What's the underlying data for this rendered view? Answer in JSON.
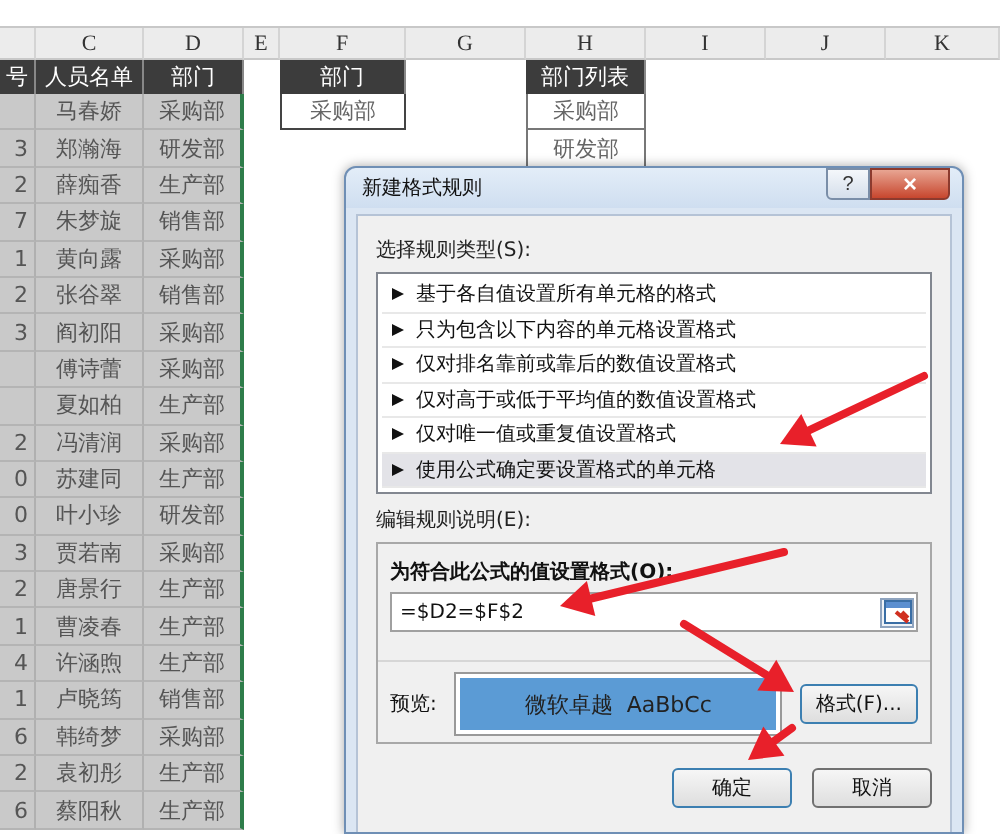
{
  "sheet": {
    "column_headers": [
      "C",
      "D",
      "E",
      "F",
      "G",
      "H",
      "I",
      "J",
      "K"
    ],
    "table_headers": [
      "号",
      "人员名单",
      "部门"
    ],
    "rows": [
      [
        "",
        "马春娇",
        "采购部"
      ],
      [
        "3",
        "郑瀚海",
        "研发部"
      ],
      [
        "2",
        "薛痴香",
        "生产部"
      ],
      [
        "7",
        "朱梦旋",
        "销售部"
      ],
      [
        "1",
        "黄向露",
        "采购部"
      ],
      [
        "2",
        "张谷翠",
        "销售部"
      ],
      [
        "3",
        "阎初阳",
        "采购部"
      ],
      [
        "",
        "傅诗蕾",
        "采购部"
      ],
      [
        "",
        "夏如柏",
        "生产部"
      ],
      [
        "2",
        "冯清润",
        "采购部"
      ],
      [
        "0",
        "苏建同",
        "生产部"
      ],
      [
        "0",
        "叶小珍",
        "研发部"
      ],
      [
        "3",
        "贾若南",
        "采购部"
      ],
      [
        "2",
        "唐景行",
        "生产部"
      ],
      [
        "1",
        "曹凌春",
        "生产部"
      ],
      [
        "4",
        "许涵煦",
        "生产部"
      ],
      [
        "1",
        "卢晓筠",
        "销售部"
      ],
      [
        "6",
        "韩绮梦",
        "采购部"
      ],
      [
        "2",
        "袁初彤",
        "生产部"
      ],
      [
        "6",
        "蔡阳秋",
        "生产部"
      ]
    ],
    "criteria": {
      "header": "部门",
      "value": "采购部"
    },
    "dept_list": {
      "header": "部门列表",
      "items": [
        "采购部",
        "研发部"
      ]
    }
  },
  "dialog": {
    "title": "新建格式规则",
    "help": "?",
    "close": "×",
    "rule_type_label": "选择规则类型(S):",
    "rule_types": [
      {
        "label": "基于各自值设置所有单元格的格式",
        "selected": false
      },
      {
        "label": "只为包含以下内容的单元格设置格式",
        "selected": false
      },
      {
        "label": "仅对排名靠前或靠后的数值设置格式",
        "selected": false
      },
      {
        "label": "仅对高于或低于平均值的数值设置格式",
        "selected": false
      },
      {
        "label": "仅对唯一值或重复值设置格式",
        "selected": false
      },
      {
        "label": "使用公式确定要设置格式的单元格",
        "selected": true
      }
    ],
    "edit_label": "编辑规则说明(E):",
    "formula_label": "为符合此公式的值设置格式(O):",
    "formula": "=$D2=$F$2",
    "preview_label": "预览:",
    "preview_text": "微软卓越  AaBbCc",
    "format_button": "格式(F)...",
    "ok": "确定",
    "cancel": "取消"
  }
}
